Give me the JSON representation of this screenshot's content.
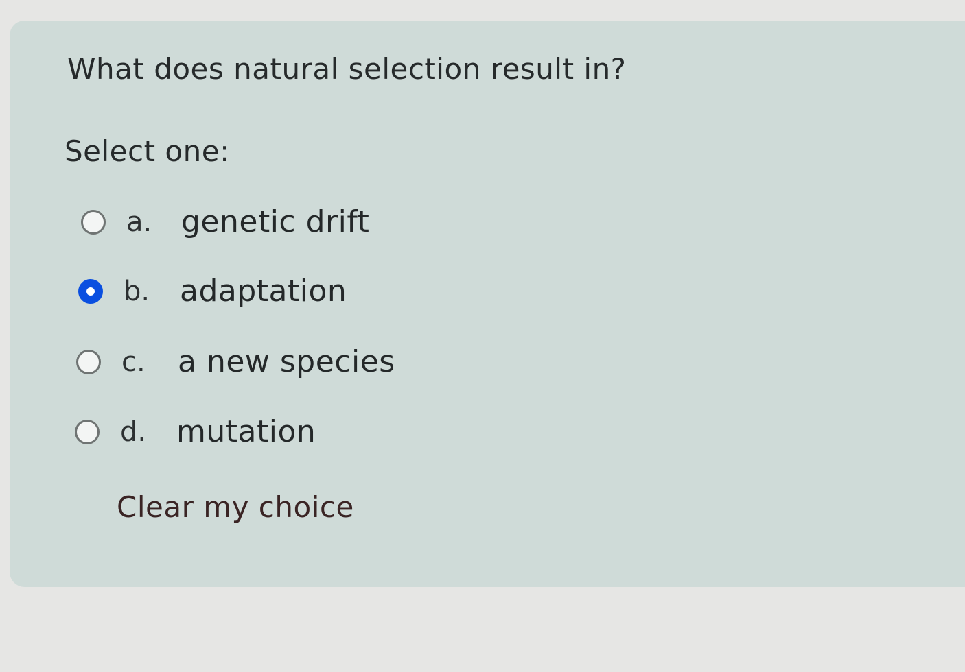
{
  "question": {
    "text": "What does natural selection result in?",
    "prompt": "Select one:"
  },
  "options": [
    {
      "letter": "a.",
      "label": "genetic drift",
      "selected": false
    },
    {
      "letter": "b.",
      "label": "adaptation",
      "selected": true
    },
    {
      "letter": "c.",
      "label": "a new species",
      "selected": false
    },
    {
      "letter": "d.",
      "label": "mutation",
      "selected": false
    }
  ],
  "actions": {
    "clear_label": "Clear my choice"
  },
  "colors": {
    "card_background": "#cfdbd8",
    "radio_selected": "#0a4fe0",
    "page_background": "#e6e6e4"
  }
}
